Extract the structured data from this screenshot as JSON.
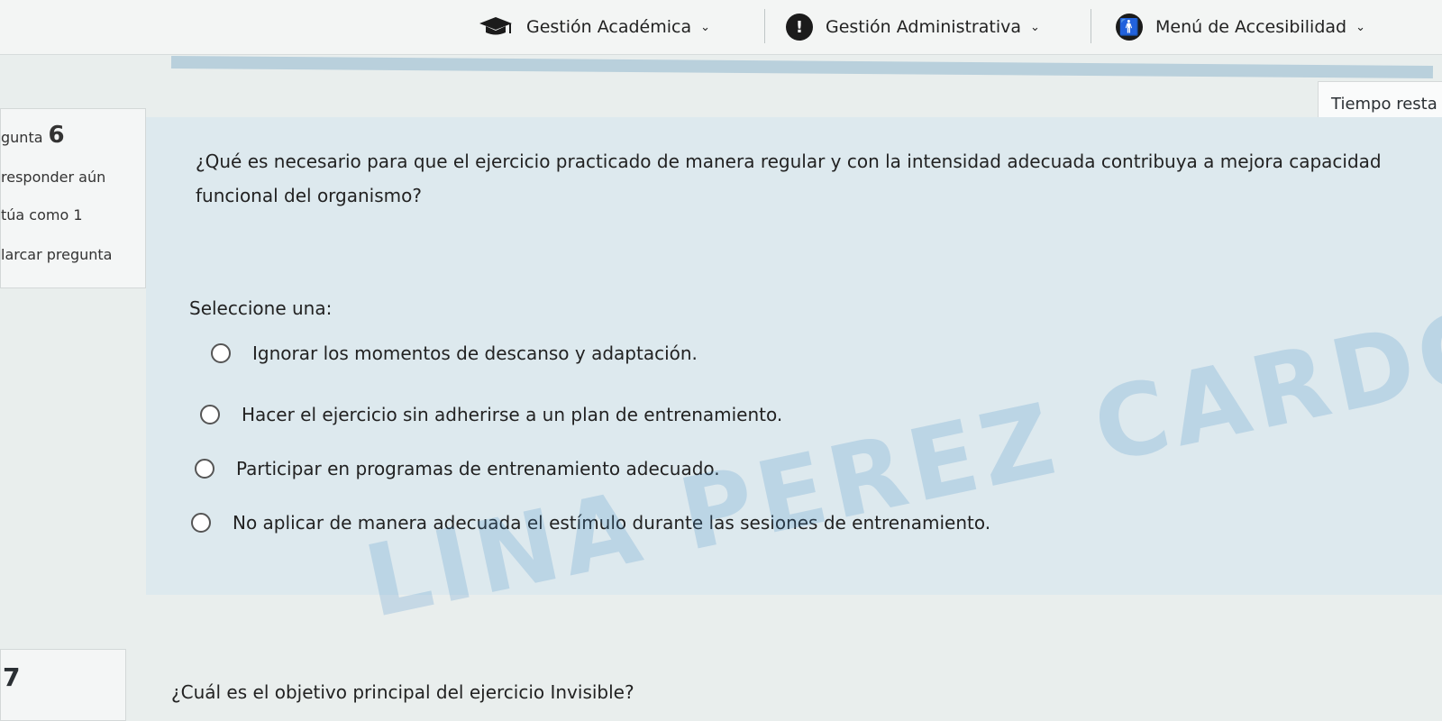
{
  "nav": {
    "items": [
      {
        "label": "Gestión Académica",
        "icon": "graduation-cap-icon"
      },
      {
        "label": "Gestión Administrativa",
        "icon": "alert-icon"
      },
      {
        "label": "Menú de Accesibilidad",
        "icon": "accessibility-icon"
      }
    ]
  },
  "timer": {
    "label": "Tiempo resta"
  },
  "question_info": {
    "number_label": "gunta",
    "number": "6",
    "status": "responder aún",
    "score": "túa como 1",
    "flag": "larcar pregunta"
  },
  "question": {
    "text": "¿Qué es necesario para que el ejercicio practicado de manera regular y con la intensidad adecuada contribuya a mejora capacidad funcional del organismo?",
    "select_label": "Seleccione una:",
    "options": [
      "Ignorar los momentos de descanso y adaptación.",
      "Hacer el ejercicio sin adherirse a un plan de entrenamiento.",
      "Participar en programas de entrenamiento adecuado.",
      "No aplicar de manera adecuada el estímulo durante las sesiones de entrenamiento."
    ]
  },
  "watermark": "LINA PEREZ CARDOSO",
  "next_question": {
    "number": "7",
    "text": "¿Cuál es el objetivo principal del ejercicio Invisible?"
  }
}
